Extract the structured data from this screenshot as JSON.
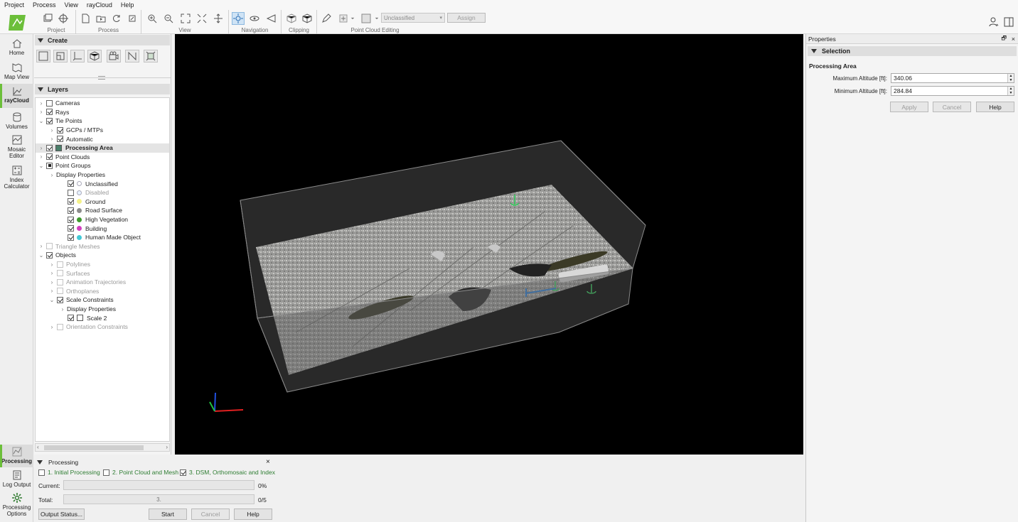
{
  "menu": [
    "Project",
    "Process",
    "View",
    "rayCloud",
    "Help"
  ],
  "toolbar": {
    "groups": [
      "Project",
      "Process",
      "View",
      "Navigation",
      "Clipping",
      "Point Cloud Editing"
    ],
    "class_select": "Unclassified",
    "assign_label": "Assign"
  },
  "sidebar": {
    "home": "Home",
    "map_view": "Map View",
    "raycloud": "rayCloud",
    "volumes": "Volumes",
    "mosaic_editor": "Mosaic Editor",
    "index_calculator": "Index Calculator",
    "processing": "Processing",
    "log_output": "Log Output",
    "processing_options": "Processing Options"
  },
  "create": {
    "title": "Create"
  },
  "layers": {
    "title": "Layers",
    "rows": [
      {
        "label": "Cameras",
        "indent": 0,
        "exp": ">",
        "cb": "off"
      },
      {
        "label": "Rays",
        "indent": 0,
        "exp": ">",
        "cb": "on"
      },
      {
        "label": "Tie Points",
        "indent": 0,
        "exp": "v",
        "cb": "on"
      },
      {
        "label": "GCPs / MTPs",
        "indent": 1,
        "exp": ">",
        "cb": "on"
      },
      {
        "label": "Automatic",
        "indent": 1,
        "exp": ">",
        "cb": "on"
      },
      {
        "label": "Processing Area",
        "indent": 0,
        "exp": ">",
        "cb": "on",
        "icon": "#4a7f6a",
        "bold": true,
        "sel": true
      },
      {
        "label": "Point Clouds",
        "indent": 0,
        "exp": ">",
        "cb": "on"
      },
      {
        "label": "Point Groups",
        "indent": 0,
        "exp": "v",
        "cb": "part"
      },
      {
        "label": "Display Properties",
        "indent": 1,
        "exp": ">",
        "cb": "none"
      },
      {
        "label": "Unclassified",
        "indent": 2,
        "exp": "",
        "cb": "on",
        "dot": "#ffffff"
      },
      {
        "label": "Disabled",
        "indent": 2,
        "exp": "",
        "cb": "off",
        "dot": "#e8f3ff",
        "cls": "grey"
      },
      {
        "label": "Ground",
        "indent": 2,
        "exp": "",
        "cb": "on",
        "dot": "#f4f18a"
      },
      {
        "label": "Road Surface",
        "indent": 2,
        "exp": "",
        "cb": "on",
        "dot": "#8c8c8c"
      },
      {
        "label": "High Vegetation",
        "indent": 2,
        "exp": "",
        "cb": "on",
        "dot": "#3e9a2c"
      },
      {
        "label": "Building",
        "indent": 2,
        "exp": "",
        "cb": "on",
        "dot": "#d43fbf"
      },
      {
        "label": "Human Made Object",
        "indent": 2,
        "exp": "",
        "cb": "on",
        "dot": "#43c9d6"
      },
      {
        "label": "Triangle Meshes",
        "indent": 0,
        "exp": ">",
        "cb": "dis",
        "cls": "grey"
      },
      {
        "label": "Objects",
        "indent": 0,
        "exp": "v",
        "cb": "on"
      },
      {
        "label": "Polylines",
        "indent": 1,
        "exp": ">",
        "cb": "dis",
        "cls": "grey"
      },
      {
        "label": "Surfaces",
        "indent": 1,
        "exp": ">",
        "cb": "dis",
        "cls": "grey"
      },
      {
        "label": "Animation Trajectories",
        "indent": 1,
        "exp": ">",
        "cb": "dis",
        "cls": "grey"
      },
      {
        "label": "Orthoplanes",
        "indent": 1,
        "exp": ">",
        "cb": "dis",
        "cls": "grey"
      },
      {
        "label": "Scale Constraints",
        "indent": 1,
        "exp": "v",
        "cb": "on"
      },
      {
        "label": "Display Properties",
        "indent": 2,
        "exp": ">",
        "cb": "none"
      },
      {
        "label": "Scale 2",
        "indent": 2,
        "exp": "",
        "cb": "on",
        "icon": "#ffffff"
      },
      {
        "label": "Orientation Constraints",
        "indent": 1,
        "exp": ">",
        "cb": "dis",
        "cls": "grey"
      }
    ]
  },
  "processing": {
    "title": "Processing",
    "close": "×",
    "step1": "1. Initial Processing",
    "step2": "2. Point Cloud and Mesh",
    "step3": "3. DSM, Orthomosaic and Index",
    "current_label": "Current:",
    "current_pct": "0%",
    "total_label": "Total:",
    "total_bar": "3.",
    "total_count": "0/5",
    "output_status": "Output Status...",
    "start": "Start",
    "cancel": "Cancel",
    "help": "Help"
  },
  "properties": {
    "title": "Properties",
    "section": "Selection",
    "subsection": "Processing Area",
    "max_label": "Maximum Altitude [ft]:",
    "max_value": "340.06",
    "min_label": "Minimum Altitude [ft]:",
    "min_value": "284.84",
    "apply": "Apply",
    "cancel": "Cancel",
    "help": "Help"
  },
  "colors": {
    "accent_green": "#6cbf3a",
    "viewport_bg": "#000000",
    "axis_x": "#e02020",
    "axis_y": "#20c040",
    "axis_z": "#2050e0"
  }
}
